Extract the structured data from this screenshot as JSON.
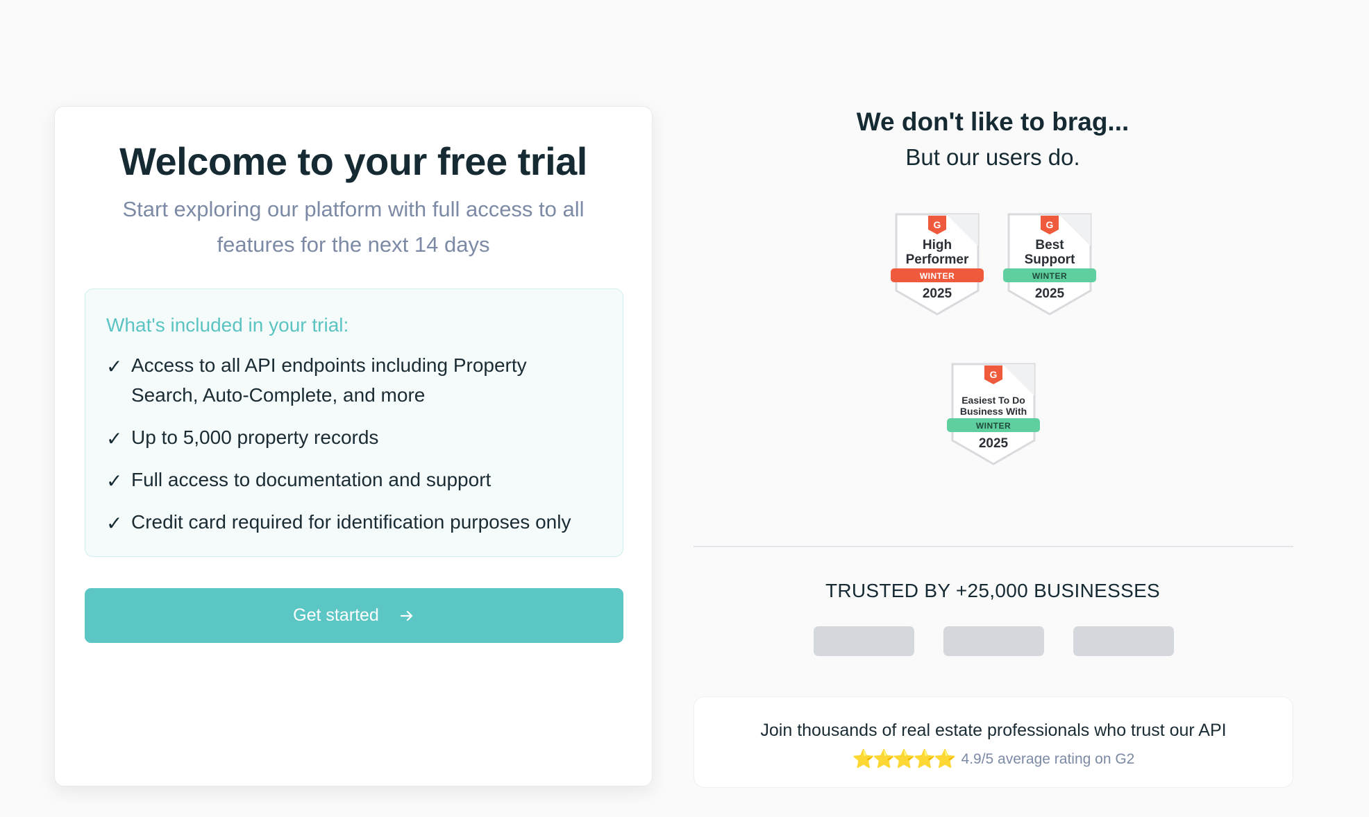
{
  "trial_card": {
    "title": "Welcome to your free trial",
    "subtitle": "Start exploring our platform with full access to all features for the next 14 days",
    "included_heading": "What's included in your trial:",
    "check_glyph": "✓",
    "features": [
      "Access to all API endpoints including Property Search, Auto-Complete, and more",
      "Up to 5,000 property records",
      "Full access to documentation and support",
      "Credit card required for identification purposes only"
    ],
    "cta_label": "Get started",
    "cta_icon": "arrow-right-icon"
  },
  "social_proof": {
    "title": "We don't like to brag...",
    "subtitle": "But our users do.",
    "badges": [
      {
        "line1": "High",
        "line2": "Performer",
        "season": "WINTER",
        "year": "2025",
        "ribbon_color": "#ef5a3c",
        "icon": "g2-logo-icon"
      },
      {
        "line1": "Best",
        "line2": "Support",
        "season": "WINTER",
        "year": "2025",
        "ribbon_color": "#5fcf9f",
        "icon": "g2-logo-icon"
      },
      {
        "line1": "Easiest To Do",
        "line2": "Business With",
        "season": "WINTER",
        "year": "2025",
        "ribbon_color": "#5fcf9f",
        "icon": "g2-logo-icon"
      }
    ],
    "trusted_heading": "TRUSTED BY +25,000 BUSINESSES",
    "join_text": "Join thousands of real estate professionals who trust our API",
    "stars": "⭐⭐⭐⭐⭐",
    "rating_text": "4.9/5 average rating on G2"
  },
  "colors": {
    "accent": "#5cc6c5",
    "heading": "#152a32",
    "muted": "#7c8aa5",
    "g2_red": "#ef5a3c",
    "badge_green": "#5fcf9f"
  }
}
